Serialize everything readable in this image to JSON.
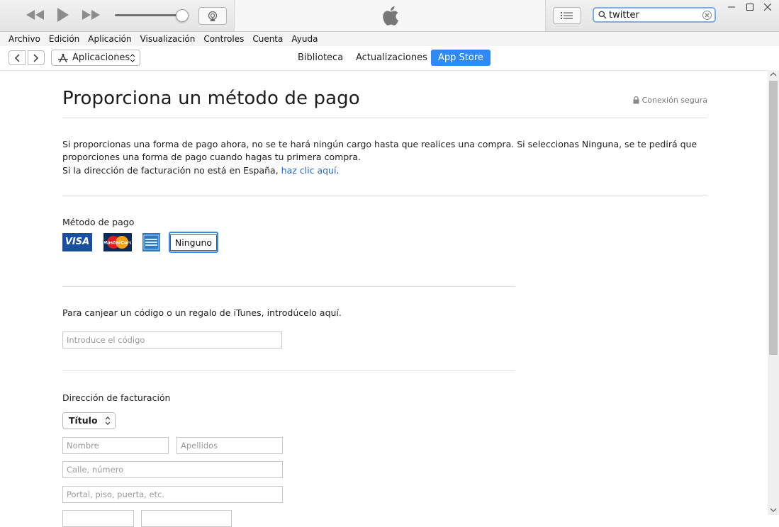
{
  "player": {
    "search_value": "twitter"
  },
  "menu": [
    "Archivo",
    "Edición",
    "Aplicación",
    "Visualización",
    "Controles",
    "Cuenta",
    "Ayuda"
  ],
  "nav": {
    "media_label": "Aplicaciones",
    "tabs": [
      {
        "label": "Biblioteca",
        "active": false
      },
      {
        "label": "Actualizaciones",
        "active": false
      },
      {
        "label": "App Store",
        "active": true
      }
    ]
  },
  "page": {
    "title": "Proporciona un método de pago",
    "secure_label": "Conexión segura",
    "intro_line1": "Si proporcionas una forma de pago ahora, no se te hará ningún cargo hasta que realices una compra. Si seleccionas Ninguna, se te pedirá que",
    "intro_line2": "proporciones una forma de pago cuando hagas tu primera compra.",
    "billing_note": "Si la dirección de facturación no está en España,",
    "billing_link": "haz clic aquí",
    "billing_tail": "."
  },
  "payment": {
    "label": "Método de pago",
    "visa": "VISA",
    "mastercard": "MasterCard",
    "none_label": "Ninguno"
  },
  "redeem": {
    "label": "Para canjear un código o un regalo de iTunes, introdúcelo aquí.",
    "placeholder": "Introduce el código"
  },
  "billing": {
    "label": "Dirección de facturación",
    "title_select": "Título",
    "first_name_placeholder": "Nombre",
    "last_name_placeholder": "Apellidos",
    "street_placeholder": "Calle, número",
    "portal_placeholder": "Portal, piso, puerta, etc."
  },
  "colors": {
    "accent": "#2f8af5",
    "link": "#2367c6",
    "visa": "#1a4fa0",
    "mastercard_bg": "#0b2a55",
    "amex": "#2a7ac6"
  }
}
